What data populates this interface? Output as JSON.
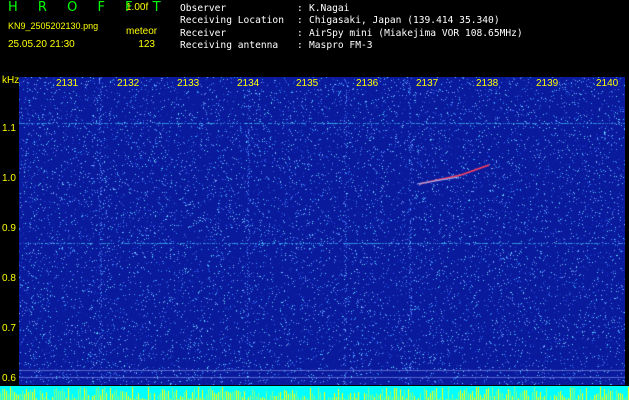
{
  "header": {
    "logo": "H R O F F T",
    "version": "1.00f",
    "filename": "KN9_2505202130.png",
    "mode": "meteor",
    "datetime": "25.05.20 21:30",
    "count": "123"
  },
  "info": [
    {
      "key": "Observer",
      "value": "K.Nagai"
    },
    {
      "key": "Receiving Location",
      "value": "Chigasaki, Japan (139.414 35.340)"
    },
    {
      "key": "Receiver",
      "value": "AirSpy mini (Miakejima VOR 108.65MHz)"
    },
    {
      "key": "Receiving antenna",
      "value": "Maspro FM-3"
    }
  ],
  "axes": {
    "y_unit": "kHz",
    "y_ticks": [
      "1.1",
      "1.0",
      "0.9",
      "0.8",
      "0.7",
      "0.6"
    ],
    "x_ticks": [
      "2131",
      "2132",
      "2133",
      "2134",
      "2135",
      "2136",
      "2137",
      "2138",
      "2139",
      "2140"
    ]
  },
  "colors": {
    "background": "#000000",
    "label": "#ffff00",
    "logo": "#00ff00",
    "info_text": "#ffffff",
    "spectrum_base": "#0a1a9c",
    "noise": "#3a6cff",
    "line": "#40c0ff",
    "meteor_trace": "#ff4060"
  }
}
